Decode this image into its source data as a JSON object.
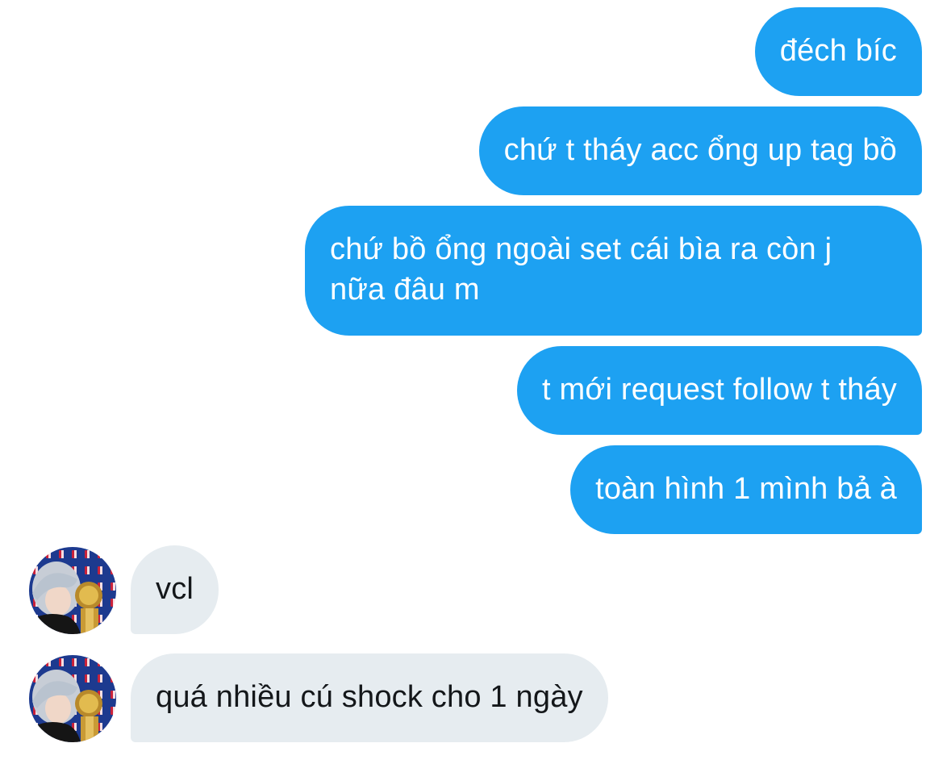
{
  "conversation": {
    "sent": [
      {
        "text": "đéch bíc"
      },
      {
        "text": "chứ t tháy acc ổng up tag bồ"
      },
      {
        "text": "chứ bồ ổng ngoài set cái bìa ra còn j nữa đâu m"
      },
      {
        "text": "t mới request follow t tháy"
      },
      {
        "text": "toàn hình 1 mình bả à"
      }
    ],
    "received": [
      {
        "text": "vcl"
      },
      {
        "text": "quá nhiều cú shock cho 1 ngày"
      }
    ]
  },
  "colors": {
    "sent_bubble": "#1da1f2",
    "received_bubble": "#e6ecf0",
    "sent_text": "#ffffff",
    "received_text": "#14171a"
  },
  "icons": {
    "avatar": "contact-avatar-photo"
  }
}
